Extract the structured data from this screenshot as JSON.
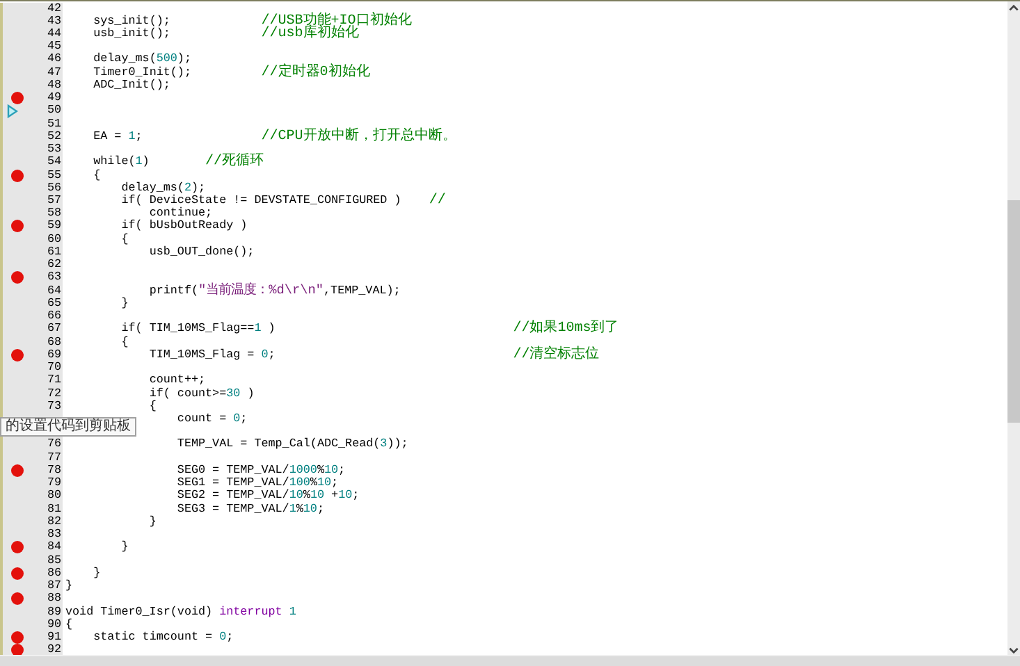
{
  "editor": {
    "lines": [
      {
        "number": "42",
        "breakpoint": false,
        "current": false
      },
      {
        "number": "43",
        "breakpoint": false,
        "current": false,
        "code": [
          {
            "text": "    sys_init();",
            "kind": "plain"
          }
        ],
        "comment": "             //USB功能+IO口初始化"
      },
      {
        "number": "44",
        "breakpoint": false,
        "current": false,
        "code": [
          {
            "text": "    usb_init();",
            "kind": "plain"
          }
        ],
        "comment": "             //usb库初始化"
      },
      {
        "number": "45",
        "breakpoint": false,
        "current": false
      },
      {
        "number": "46",
        "breakpoint": false,
        "current": false,
        "code": [
          {
            "text": "    delay_ms(",
            "kind": "plain"
          },
          {
            "text": "500",
            "kind": "number"
          },
          {
            "text": ");",
            "kind": "plain"
          }
        ]
      },
      {
        "number": "47",
        "breakpoint": false,
        "current": false,
        "code": [
          {
            "text": "    Timer0_Init();",
            "kind": "plain"
          }
        ],
        "comment": "          //定时器0初始化"
      },
      {
        "number": "48",
        "breakpoint": false,
        "current": false,
        "code": [
          {
            "text": "    ADC_Init();",
            "kind": "plain"
          }
        ]
      },
      {
        "number": "49",
        "breakpoint": true,
        "current": false
      },
      {
        "number": "50",
        "breakpoint": false,
        "current": true
      },
      {
        "number": "51",
        "breakpoint": false,
        "current": false
      },
      {
        "number": "52",
        "breakpoint": false,
        "current": false,
        "code": [
          {
            "text": "    EA = ",
            "kind": "plain"
          },
          {
            "text": "1",
            "kind": "number"
          },
          {
            "text": ";",
            "kind": "plain"
          }
        ],
        "comment": "                 //CPU开放中断，打开总中断。"
      },
      {
        "number": "53",
        "breakpoint": false,
        "current": false
      },
      {
        "number": "54",
        "breakpoint": false,
        "current": false,
        "code": [
          {
            "text": "    while(",
            "kind": "plain"
          },
          {
            "text": "1",
            "kind": "number"
          },
          {
            "text": ")",
            "kind": "plain"
          }
        ],
        "comment": "        //死循环"
      },
      {
        "number": "55",
        "breakpoint": true,
        "current": false,
        "code": [
          {
            "text": "    {",
            "kind": "plain"
          }
        ]
      },
      {
        "number": "56",
        "breakpoint": false,
        "current": false,
        "code": [
          {
            "text": "        delay_ms(",
            "kind": "plain"
          },
          {
            "text": "2",
            "kind": "number"
          },
          {
            "text": ");",
            "kind": "plain"
          }
        ]
      },
      {
        "number": "57",
        "breakpoint": false,
        "current": false,
        "code": [
          {
            "text": "        if( DeviceState != DEVSTATE_CONFIGURED )",
            "kind": "plain"
          }
        ],
        "comment": "    //"
      },
      {
        "number": "58",
        "breakpoint": false,
        "current": false,
        "code": [
          {
            "text": "            continue;",
            "kind": "plain"
          }
        ]
      },
      {
        "number": "59",
        "breakpoint": true,
        "current": false,
        "code": [
          {
            "text": "        if( bUsbOutReady )",
            "kind": "plain"
          }
        ]
      },
      {
        "number": "60",
        "breakpoint": false,
        "current": false,
        "code": [
          {
            "text": "        {",
            "kind": "plain"
          }
        ]
      },
      {
        "number": "61",
        "breakpoint": false,
        "current": false,
        "code": [
          {
            "text": "            usb_OUT_done();",
            "kind": "plain"
          }
        ]
      },
      {
        "number": "62",
        "breakpoint": false,
        "current": false
      },
      {
        "number": "63",
        "breakpoint": true,
        "current": false
      },
      {
        "number": "64",
        "breakpoint": false,
        "current": false,
        "code": [
          {
            "text": "            printf(",
            "kind": "plain"
          },
          {
            "text": "\"当前温度：%d\\r\\n\"",
            "kind": "string"
          },
          {
            "text": ",TEMP_VAL);",
            "kind": "plain"
          }
        ]
      },
      {
        "number": "65",
        "breakpoint": false,
        "current": false,
        "code": [
          {
            "text": "        }",
            "kind": "plain"
          }
        ]
      },
      {
        "number": "66",
        "breakpoint": false,
        "current": false
      },
      {
        "number": "67",
        "breakpoint": false,
        "current": false,
        "code": [
          {
            "text": "        if( TIM_10MS_Flag==",
            "kind": "plain"
          },
          {
            "text": "1",
            "kind": "number"
          },
          {
            "text": " )",
            "kind": "plain"
          }
        ],
        "comment": "                                  //如果10ms到了"
      },
      {
        "number": "68",
        "breakpoint": false,
        "current": false,
        "code": [
          {
            "text": "        {",
            "kind": "plain"
          }
        ]
      },
      {
        "number": "69",
        "breakpoint": true,
        "current": false,
        "code": [
          {
            "text": "            TIM_10MS_Flag = ",
            "kind": "plain"
          },
          {
            "text": "0",
            "kind": "number"
          },
          {
            "text": ";",
            "kind": "plain"
          }
        ],
        "comment": "                                  //清空标志位"
      },
      {
        "number": "70",
        "breakpoint": false,
        "current": false
      },
      {
        "number": "71",
        "breakpoint": false,
        "current": false,
        "code": [
          {
            "text": "            count++;",
            "kind": "plain"
          }
        ]
      },
      {
        "number": "72",
        "breakpoint": false,
        "current": false,
        "code": [
          {
            "text": "            if( count>=",
            "kind": "plain"
          },
          {
            "text": "30",
            "kind": "number"
          },
          {
            "text": " )",
            "kind": "plain"
          }
        ]
      },
      {
        "number": "73",
        "breakpoint": false,
        "current": false,
        "code": [
          {
            "text": "            {",
            "kind": "plain"
          }
        ]
      },
      {
        "breakpoint": false,
        "current": false,
        "code": [
          {
            "text": "                count = ",
            "kind": "plain"
          },
          {
            "text": "0",
            "kind": "number"
          },
          {
            "text": ";",
            "kind": "plain"
          }
        ]
      },
      {
        "breakpoint": false,
        "current": false
      },
      {
        "number": "76",
        "breakpoint": false,
        "current": false,
        "code": [
          {
            "text": "                TEMP_VAL = Temp_Cal(ADC_Read(",
            "kind": "plain"
          },
          {
            "text": "3",
            "kind": "number"
          },
          {
            "text": "));",
            "kind": "plain"
          }
        ]
      },
      {
        "number": "77",
        "breakpoint": false,
        "current": false
      },
      {
        "number": "78",
        "breakpoint": true,
        "current": false,
        "code": [
          {
            "text": "                SEG0 = TEMP_VAL/",
            "kind": "plain"
          },
          {
            "text": "1000",
            "kind": "number"
          },
          {
            "text": "%",
            "kind": "plain"
          },
          {
            "text": "10",
            "kind": "number"
          },
          {
            "text": ";",
            "kind": "plain"
          }
        ]
      },
      {
        "number": "79",
        "breakpoint": false,
        "current": false,
        "code": [
          {
            "text": "                SEG1 = TEMP_VAL/",
            "kind": "plain"
          },
          {
            "text": "100",
            "kind": "number"
          },
          {
            "text": "%",
            "kind": "plain"
          },
          {
            "text": "10",
            "kind": "number"
          },
          {
            "text": ";",
            "kind": "plain"
          }
        ]
      },
      {
        "number": "80",
        "breakpoint": false,
        "current": false,
        "code": [
          {
            "text": "                SEG2 = TEMP_VAL/",
            "kind": "plain"
          },
          {
            "text": "10",
            "kind": "number"
          },
          {
            "text": "%",
            "kind": "plain"
          },
          {
            "text": "10",
            "kind": "number"
          },
          {
            "text": " +",
            "kind": "plain"
          },
          {
            "text": "10",
            "kind": "number"
          },
          {
            "text": ";",
            "kind": "plain"
          }
        ]
      },
      {
        "number": "81",
        "breakpoint": false,
        "current": false,
        "code": [
          {
            "text": "                SEG3 = TEMP_VAL/",
            "kind": "plain"
          },
          {
            "text": "1",
            "kind": "number"
          },
          {
            "text": "%",
            "kind": "plain"
          },
          {
            "text": "10",
            "kind": "number"
          },
          {
            "text": ";",
            "kind": "plain"
          }
        ]
      },
      {
        "number": "82",
        "breakpoint": false,
        "current": false,
        "code": [
          {
            "text": "            }",
            "kind": "plain"
          }
        ]
      },
      {
        "number": "83",
        "breakpoint": false,
        "current": false
      },
      {
        "number": "84",
        "breakpoint": true,
        "current": false,
        "code": [
          {
            "text": "        }",
            "kind": "plain"
          }
        ]
      },
      {
        "number": "85",
        "breakpoint": false,
        "current": false
      },
      {
        "number": "86",
        "breakpoint": true,
        "current": false,
        "code": [
          {
            "text": "    }",
            "kind": "plain"
          }
        ]
      },
      {
        "number": "87",
        "breakpoint": false,
        "current": false,
        "code": [
          {
            "text": "}",
            "kind": "plain"
          }
        ]
      },
      {
        "number": "88",
        "breakpoint": true,
        "current": false
      },
      {
        "number": "89",
        "breakpoint": false,
        "current": false,
        "code": [
          {
            "text": "void Timer0_Isr(void) ",
            "kind": "plain"
          },
          {
            "text": "interrupt",
            "kind": "keyword"
          },
          {
            "text": " 1",
            "kind": "number"
          }
        ]
      },
      {
        "number": "90",
        "breakpoint": false,
        "current": false,
        "code": [
          {
            "text": "{",
            "kind": "plain"
          }
        ]
      },
      {
        "number": "91",
        "breakpoint": true,
        "current": false,
        "code": [
          {
            "text": "    static timcount = ",
            "kind": "plain"
          },
          {
            "text": "0",
            "kind": "number"
          },
          {
            "text": ";",
            "kind": "plain"
          }
        ]
      },
      {
        "number": "92",
        "breakpoint": true,
        "current": false
      }
    ]
  },
  "tooltip": "的设置代码到剪贴板"
}
